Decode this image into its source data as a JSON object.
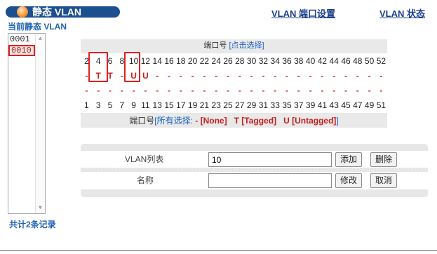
{
  "header": {
    "title": "静态 VLAN",
    "links": [
      "VLAN 端口设置",
      "VLAN 状态"
    ]
  },
  "vlan_list": {
    "label": "当前静态 VLAN",
    "items": [
      "0001",
      "0010"
    ],
    "selected_index": 1,
    "records": "共计2条记录"
  },
  "port_table": {
    "heading_label": "端口号",
    "heading_link": "[点击选择]",
    "even_ports": [
      "2",
      "4",
      "6",
      "8",
      "10",
      "12",
      "14",
      "16",
      "18",
      "20",
      "22",
      "24",
      "26",
      "28",
      "30",
      "32",
      "34",
      "36",
      "38",
      "40",
      "42",
      "44",
      "46",
      "48",
      "50",
      "52"
    ],
    "even_marks": [
      "-",
      "T",
      "T",
      "-",
      "U",
      "U",
      "-",
      "-",
      "-",
      "-",
      "-",
      "-",
      "-",
      "-",
      "-",
      "-",
      "-",
      "-",
      "-",
      "-",
      "-",
      "-",
      "-",
      "-",
      "-",
      "-"
    ],
    "odd_marks": [
      "-",
      "-",
      "-",
      "-",
      "-",
      "-",
      "-",
      "-",
      "-",
      "-",
      "-",
      "-",
      "-",
      "-",
      "-",
      "-",
      "-",
      "-",
      "-",
      "-",
      "-",
      "-",
      "-",
      "-",
      "-",
      "-"
    ],
    "odd_ports": [
      "1",
      "3",
      "5",
      "7",
      "9",
      "11",
      "13",
      "15",
      "17",
      "19",
      "21",
      "23",
      "25",
      "27",
      "29",
      "31",
      "33",
      "35",
      "37",
      "39",
      "41",
      "43",
      "45",
      "47",
      "49",
      "51"
    ],
    "footer_label": "端口号",
    "footer_link": "[所有选择:",
    "options": [
      "- [None]",
      "T [Tagged]",
      "U [Untagged]"
    ],
    "footer_close": "]"
  },
  "form": {
    "vlan_label": "VLAN列表",
    "vlan_value": "10",
    "add": "添加",
    "delete": "删除",
    "name_label": "名称",
    "name_value": "",
    "modify": "修改",
    "cancel": "取消"
  },
  "colors": {
    "accent": "#1b4f8f",
    "link": "#1b5fc4",
    "mark": "#c81e1e",
    "highlight_border": "#e02020"
  }
}
